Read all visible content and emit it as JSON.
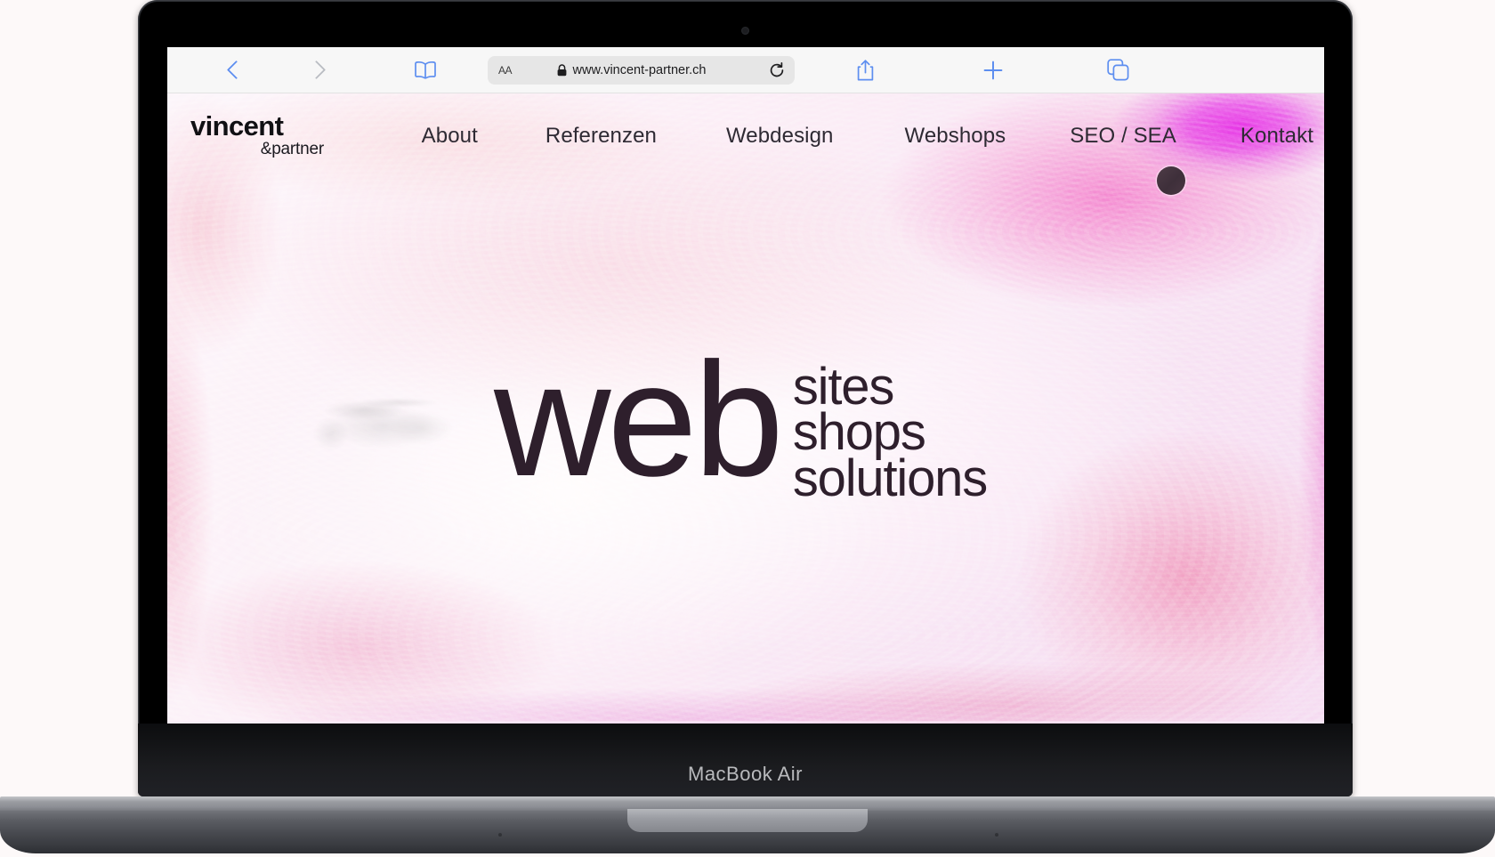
{
  "device": {
    "model_label": "MacBook Air",
    "camera_icon": "camera-dot-icon"
  },
  "browser": {
    "name": "Safari",
    "toolbar": {
      "back_icon": "chevron-left-icon",
      "forward_icon": "chevron-right-icon",
      "bookmarks_icon": "book-icon",
      "text_size_label": "AA",
      "secure_icon": "lock-icon",
      "url": "www.vincent-partner.ch",
      "reload_icon": "reload-icon",
      "share_icon": "share-icon",
      "new_tab_icon": "plus-icon",
      "tabs_icon": "tabs-icon"
    },
    "colors": {
      "toolbar_bg": "#f7f7f7",
      "url_field_bg": "#e6e6e6",
      "accent_blue": "#5d8ef0",
      "disabled_grey": "#b9bcc2"
    }
  },
  "site": {
    "logo": {
      "main": "vincent",
      "sub": "&partner"
    },
    "nav": [
      {
        "id": "about",
        "label": "About"
      },
      {
        "id": "referenzen",
        "label": "Referenzen"
      },
      {
        "id": "webdesign",
        "label": "Webdesign"
      },
      {
        "id": "webshops",
        "label": "Webshops"
      },
      {
        "id": "seosea",
        "label": "SEO / SEA"
      },
      {
        "id": "kontakt",
        "label": "Kontakt"
      }
    ],
    "hero": {
      "primary_word": "web",
      "stacked_words": [
        "sites",
        "shops",
        "solutions"
      ],
      "text_color": "#2e1f2c",
      "scroll_dot": "scroll-indicator-dot"
    },
    "background": {
      "style": "fluid-marble-art",
      "base": "#fdf6fb",
      "accent_magenta": "#e22ee2",
      "accent_pink": "#ef7fc0",
      "accent_blush": "#f4c4ce"
    }
  }
}
